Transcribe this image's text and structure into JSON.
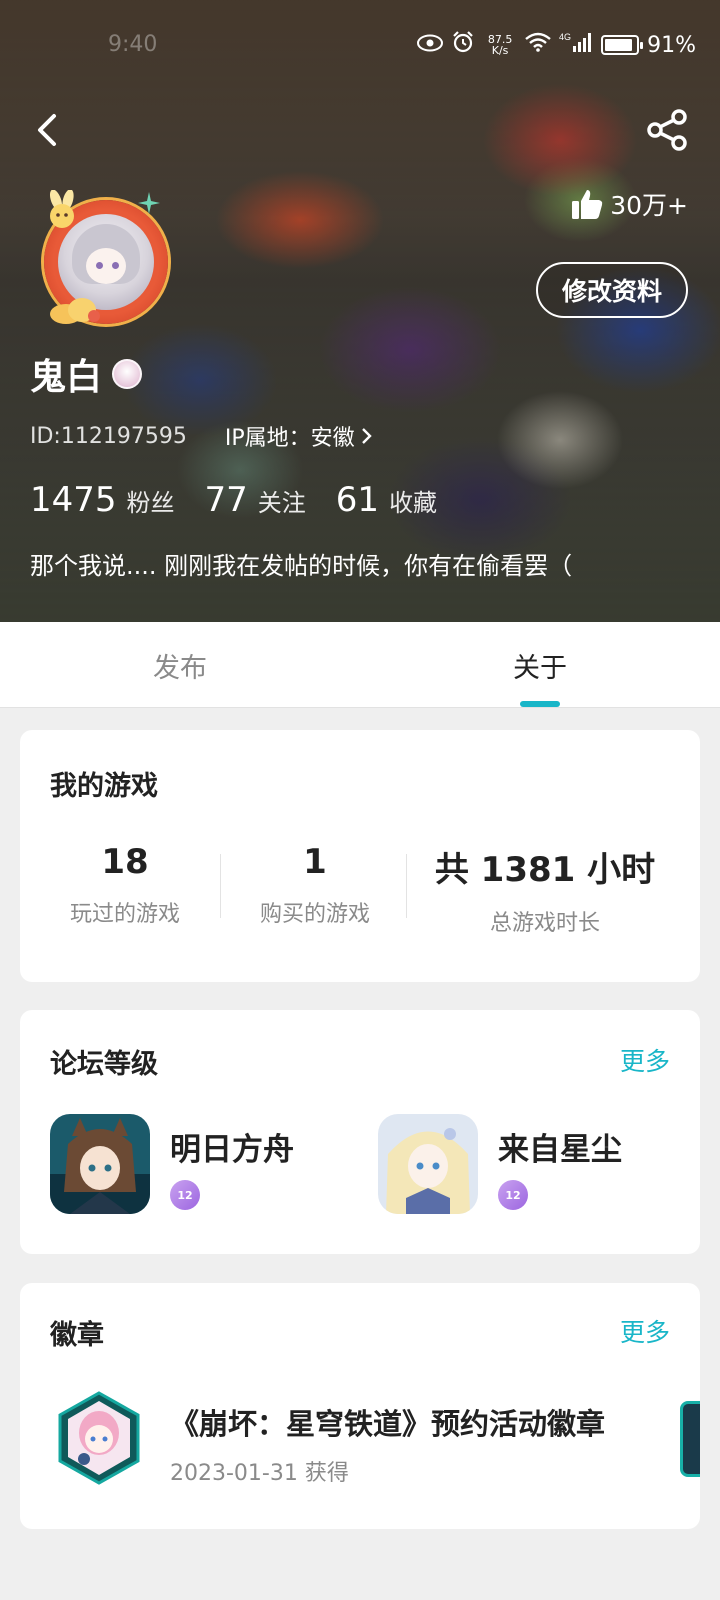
{
  "status": {
    "time": "9:40",
    "net_speed_value": "87.5",
    "net_speed_unit": "K/s",
    "network": "4G",
    "battery_percent": "91%",
    "battery_level": 0.91
  },
  "profile": {
    "likes": "30万+",
    "edit_label": "修改资料",
    "name": "鬼白",
    "id_text": "ID:112197595",
    "ip_text": "IP属地：安徽",
    "followers_count": "1475",
    "followers_label": "粉丝",
    "following_count": "77",
    "following_label": "关注",
    "favorites_count": "61",
    "favorites_label": "收藏",
    "bio": "那个我说.... 刚刚我在发帖的时候，你有在偷看罢（"
  },
  "tabs": {
    "items": [
      {
        "label": "发布",
        "active": false
      },
      {
        "label": "关于",
        "active": true
      }
    ],
    "accent_color": "#19b6c8"
  },
  "games": {
    "title": "我的游戏",
    "stats": [
      {
        "value": "18",
        "label": "玩过的游戏"
      },
      {
        "value": "1",
        "label": "购买的游戏"
      },
      {
        "value": "共 1381 小时",
        "label": "总游戏时长"
      }
    ]
  },
  "forum": {
    "title": "论坛等级",
    "more": "更多",
    "items": [
      {
        "name": "明日方舟",
        "level": "12"
      },
      {
        "name": "来自星尘",
        "level": "12"
      }
    ]
  },
  "badges": {
    "title": "徽章",
    "more": "更多",
    "items": [
      {
        "name": "《崩坏：星穹铁道》预约活动徽章",
        "date": "2023-01-31 获得"
      }
    ]
  }
}
